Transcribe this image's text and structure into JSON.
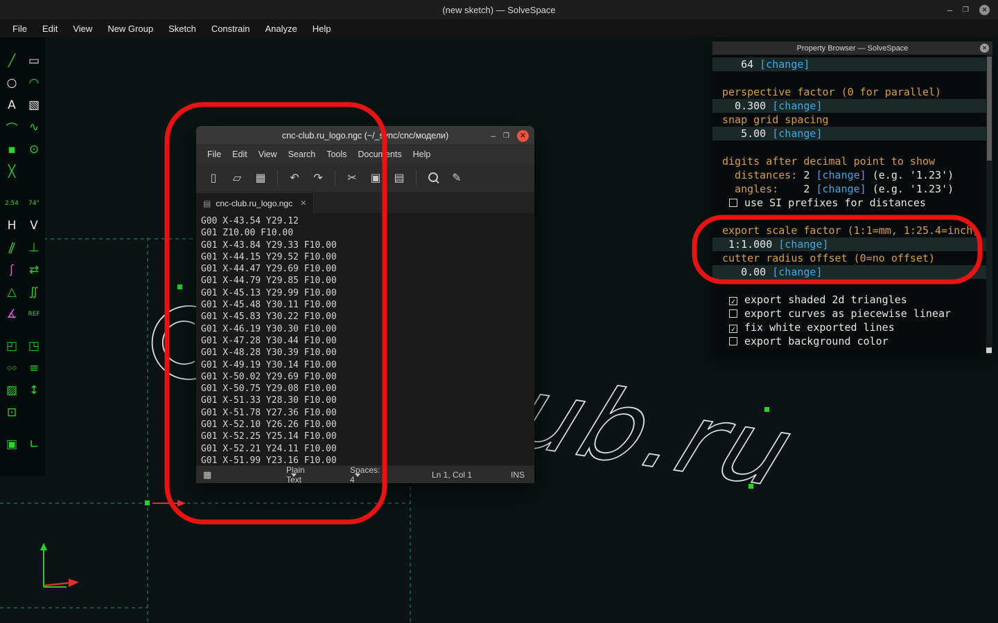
{
  "titlebar": {
    "title": "(new sketch) — SolveSpace"
  },
  "window_controls": {
    "minimize": "–",
    "restore": "❒",
    "close": "✕"
  },
  "menubar": {
    "items": [
      "File",
      "Edit",
      "View",
      "New Group",
      "Sketch",
      "Constrain",
      "Analyze",
      "Help"
    ]
  },
  "left_toolbar": {
    "rows": [
      {
        "icons": [
          {
            "n": "line-tool-icon",
            "g": "╱",
            "c": "g"
          },
          {
            "n": "rectangle-tool-icon",
            "g": "▭",
            "c": "w"
          }
        ]
      },
      {
        "icons": [
          {
            "n": "circle-tool-icon",
            "g": "○",
            "c": "w"
          },
          {
            "n": "arc-tool-icon",
            "g": "◠",
            "c": "g"
          }
        ]
      },
      {
        "icons": [
          {
            "n": "text-tool-icon",
            "g": "A",
            "c": "w"
          },
          {
            "n": "image-tool-icon",
            "g": "▧",
            "c": "w"
          }
        ]
      },
      {
        "icons": [
          {
            "n": "tangent-arc-tool-icon",
            "g": "⌒",
            "c": "g"
          },
          {
            "n": "spline-tool-icon",
            "g": "∿",
            "c": "g"
          }
        ]
      },
      {
        "icons": [
          {
            "n": "point-tool-icon",
            "g": "▪",
            "c": "g"
          },
          {
            "n": "construction-circle-tool-icon",
            "g": "⊙",
            "c": "g"
          }
        ]
      },
      {
        "icons": [
          {
            "n": "construction-line-tool-icon",
            "g": "╳",
            "c": "g"
          }
        ]
      },
      {
        "gap": true,
        "icons": [
          {
            "n": "distance-constraint-icon",
            "g": "2.54",
            "c": "g",
            "s": 1
          },
          {
            "n": "angle-constraint-icon",
            "g": "74°",
            "c": "g",
            "s": 1
          }
        ]
      },
      {
        "icons": [
          {
            "n": "horizontal-constraint-icon",
            "g": "H",
            "c": "w"
          },
          {
            "n": "vertical-constraint-icon",
            "g": "V",
            "c": "w"
          }
        ]
      },
      {
        "icons": [
          {
            "n": "parallel-constraint-icon",
            "g": "∥",
            "c": "g",
            "slant": 1
          },
          {
            "n": "perpendicular-constraint-icon",
            "g": "⊥",
            "c": "g"
          }
        ]
      },
      {
        "icons": [
          {
            "n": "on-curve-constraint-icon",
            "g": "ʃ",
            "c": "m"
          },
          {
            "n": "symmetric-constraint-icon",
            "g": "⇄",
            "c": "g"
          }
        ]
      },
      {
        "icons": [
          {
            "n": "equal-constraint-icon",
            "g": "△",
            "c": "g"
          },
          {
            "n": "curvature-constraint-icon",
            "g": "∬",
            "c": "g"
          }
        ]
      },
      {
        "icons": [
          {
            "n": "angle-bisector-constraint-icon",
            "g": "∡",
            "c": "m"
          },
          {
            "n": "reference-dimension-icon",
            "g": "REF",
            "c": "g",
            "s": 1
          }
        ]
      },
      {
        "gap": true,
        "icons": [
          {
            "n": "extrude-tool-icon",
            "g": "◰",
            "c": "g"
          },
          {
            "n": "lathe-tool-icon",
            "g": "◳",
            "c": "g"
          }
        ]
      },
      {
        "icons": [
          {
            "n": "step-translate-tool-icon",
            "g": "◇◇",
            "c": "g",
            "s": 1
          },
          {
            "n": "step-rotate-tool-icon",
            "g": "≡",
            "c": "g"
          }
        ]
      },
      {
        "icons": [
          {
            "n": "section-tool-icon",
            "g": "▨",
            "c": "g"
          },
          {
            "n": "datum-axis-tool-icon",
            "g": "↕",
            "c": "g"
          }
        ]
      },
      {
        "icons": [
          {
            "n": "image-frame-tool-icon",
            "g": "⊡",
            "c": "g"
          }
        ]
      },
      {
        "gap": true,
        "icons": [
          {
            "n": "copy-group-tool-icon",
            "g": "▣",
            "c": "g"
          },
          {
            "n": "corner-tool-icon",
            "g": "∟",
            "c": "g"
          }
        ]
      }
    ]
  },
  "canvas": {
    "logo_text": "ub.ru"
  },
  "editor": {
    "title": "cnc-club.ru_logo.ngc (~/_sync/cnc/модели)",
    "controls": {
      "minimize": "–",
      "restore": "❒",
      "close": "✕"
    },
    "menu": [
      "File",
      "Edit",
      "View",
      "Search",
      "Tools",
      "Documents",
      "Help"
    ],
    "toolbar": [
      {
        "n": "new-document-icon",
        "g": "▯"
      },
      {
        "n": "open-icon",
        "g": "▱"
      },
      {
        "n": "save-icon",
        "g": "▦"
      },
      {
        "sep": true
      },
      {
        "n": "undo-icon",
        "g": "↶"
      },
      {
        "n": "redo-icon",
        "g": "↷"
      },
      {
        "sep": true
      },
      {
        "n": "cut-icon",
        "g": "✂"
      },
      {
        "n": "copy-icon",
        "g": "▣"
      },
      {
        "n": "paste-icon",
        "g": "▤"
      },
      {
        "sep": true
      },
      {
        "n": "find-icon",
        "kind": "mag"
      },
      {
        "n": "replace-icon",
        "g": "✎"
      }
    ],
    "tab": {
      "icon_glyph": "▤",
      "label": "cnc-club.ru_logo.ngc",
      "close_glyph": "✕"
    },
    "lines": [
      "G00 X-43.54 Y29.12",
      "G01 Z10.00 F10.00",
      "G01 X-43.84 Y29.33 F10.00",
      "G01 X-44.15 Y29.52 F10.00",
      "G01 X-44.47 Y29.69 F10.00",
      "G01 X-44.79 Y29.85 F10.00",
      "G01 X-45.13 Y29.99 F10.00",
      "G01 X-45.48 Y30.11 F10.00",
      "G01 X-45.83 Y30.22 F10.00",
      "G01 X-46.19 Y30.30 F10.00",
      "G01 X-47.28 Y30.44 F10.00",
      "G01 X-48.28 Y30.39 F10.00",
      "G01 X-49.19 Y30.14 F10.00",
      "G01 X-50.02 Y29.69 F10.00",
      "G01 X-50.75 Y29.08 F10.00",
      "G01 X-51.33 Y28.30 F10.00",
      "G01 X-51.78 Y27.36 F10.00",
      "G01 X-52.10 Y26.26 F10.00",
      "G01 X-52.25 Y25.14 F10.00",
      "G01 X-52.21 Y24.11 F10.00",
      "G01 X-51.99 Y23.16 F10.00"
    ],
    "statusbar": {
      "grid_glyph": "▦",
      "language": "Plain Text",
      "spaces": "Spaces: 4",
      "position": "Ln 1, Col 1",
      "insert_mode": "INS"
    }
  },
  "property_browser": {
    "title": "Property Browser — SolveSpace",
    "close_glyph": "✕",
    "rows": [
      {
        "type": "value",
        "value": "   64",
        "link": "[change]"
      },
      {
        "type": "gap"
      },
      {
        "type": "label",
        "text": "perspective factor (0 for parallel)"
      },
      {
        "type": "value",
        "value": "  0.300",
        "link": "[change]"
      },
      {
        "type": "label",
        "text": "snap grid spacing"
      },
      {
        "type": "value",
        "value": "   5.00",
        "link": "[change]"
      },
      {
        "type": "gap"
      },
      {
        "type": "label",
        "text": "digits after decimal point to show"
      },
      {
        "type": "inline",
        "pre": "  distances: ",
        "val": "2 ",
        "link": "[change]",
        "suf": " (e.g. '1.23')"
      },
      {
        "type": "inline",
        "pre": "  angles:    ",
        "val": "2 ",
        "link": "[change]",
        "suf": " (e.g. '1.23')"
      },
      {
        "type": "checkbox",
        "checked": false,
        "text": "use SI prefixes for distances"
      },
      {
        "type": "gap"
      },
      {
        "type": "label",
        "text": "export scale factor (1:1=mm, 1:25.4=inch)"
      },
      {
        "type": "value",
        "value": " 1:1.000",
        "link": "[change]"
      },
      {
        "type": "label",
        "text": "cutter radius offset (0=no offset)"
      },
      {
        "type": "value",
        "value": "   0.00",
        "link": "[change]"
      },
      {
        "type": "gap"
      },
      {
        "type": "checkbox",
        "checked": true,
        "text": "export shaded 2d triangles"
      },
      {
        "type": "checkbox",
        "checked": false,
        "text": "export curves as piecewise linear"
      },
      {
        "type": "checkbox",
        "checked": true,
        "text": "fix white exported lines"
      },
      {
        "type": "checkbox",
        "checked": false,
        "text": "export background color"
      }
    ]
  }
}
